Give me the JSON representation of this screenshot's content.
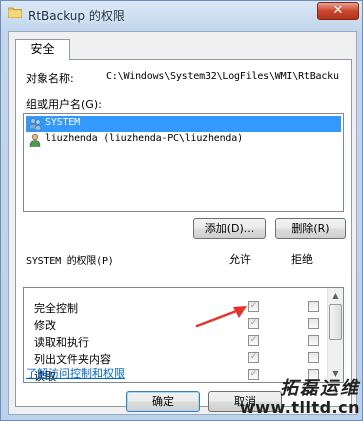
{
  "window": {
    "title": "RtBackup 的权限",
    "close_symbol": "✕"
  },
  "tab": {
    "label": "安全"
  },
  "object": {
    "label": "对象名称:",
    "value": "C:\\Windows\\System32\\LogFiles\\WMI\\RtBacku"
  },
  "users": {
    "label": "组或用户名(G):",
    "items": [
      {
        "name": "SYSTEM",
        "icon": "users-group-icon",
        "selected": true
      },
      {
        "name": "liuzhenda (liuzhenda-PC\\liuzhenda)",
        "icon": "user-icon",
        "selected": false
      }
    ]
  },
  "buttons": {
    "add": "添加(D)...",
    "remove": "删除(R)",
    "ok": "确定",
    "cancel": "取消"
  },
  "permissions": {
    "header": "SYSTEM 的权限(P)",
    "allow_header": "允许",
    "deny_header": "拒绝",
    "items": [
      {
        "name": "完全控制",
        "allow": true,
        "deny": false
      },
      {
        "name": "修改",
        "allow": true,
        "deny": false
      },
      {
        "name": "读取和执行",
        "allow": true,
        "deny": false
      },
      {
        "name": "列出文件夹内容",
        "allow": true,
        "deny": false
      },
      {
        "name": "读取",
        "allow": true,
        "deny": false
      }
    ],
    "check_mark": "✓"
  },
  "link": {
    "text": "了解访问控制和权限"
  },
  "watermark": {
    "line1": "拓磊运维",
    "line2": "www.tlltd.cn"
  },
  "colors": {
    "selection": "#3399ff",
    "link": "#0066cc",
    "annotation_arrow": "#e8322a"
  }
}
